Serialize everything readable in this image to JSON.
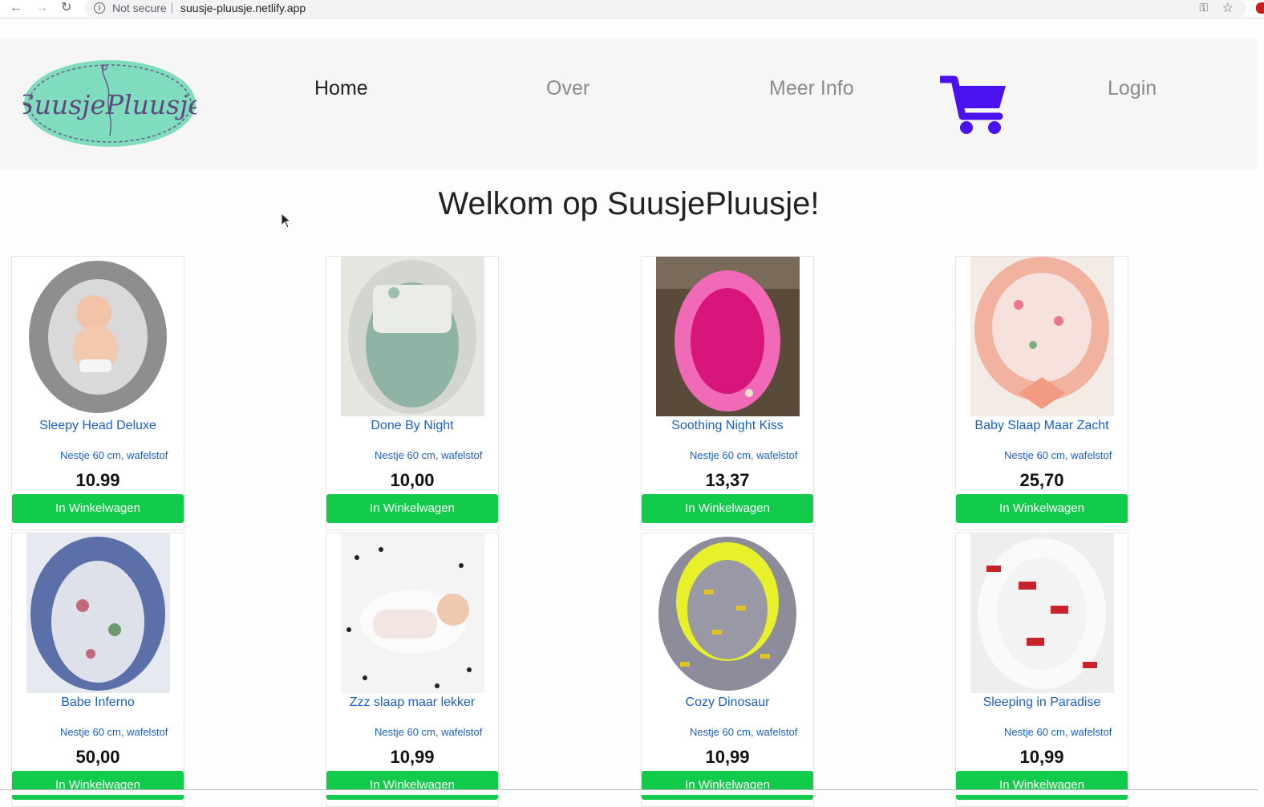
{
  "browser": {
    "security_label": "Not secure",
    "url": "suusje-pluusje.netlify.app"
  },
  "header": {
    "logo_text": "SuusjePluusje",
    "nav": {
      "home": "Home",
      "over": "Over",
      "meer_info": "Meer Info",
      "login": "Login"
    },
    "cart_icon": "shopping-cart-icon",
    "cart_color": "#4a12f0"
  },
  "main": {
    "title": "Welkom op SuusjePluusje!"
  },
  "products": [
    {
      "name": "Sleepy Head Deluxe",
      "desc": "Nestje 60 cm, wafelstof",
      "price": "10.99",
      "button": "In Winkelwagen"
    },
    {
      "name": "Done By Night",
      "desc": "Nestje 60 cm, wafelstof",
      "price": "10,00",
      "button": "In Winkelwagen"
    },
    {
      "name": "Soothing Night Kiss",
      "desc": "Nestje 60 cm, wafelstof",
      "price": "13,37",
      "button": "In Winkelwagen"
    },
    {
      "name": "Baby Slaap Maar Zacht",
      "desc": "Nestje 60 cm, wafelstof",
      "price": "25,70",
      "button": "In Winkelwagen"
    },
    {
      "name": "Babe Inferno",
      "desc": "Nestje 60 cm, wafelstof",
      "price": "50,00",
      "button": "In Winkelwagen"
    },
    {
      "name": "Zzz slaap maar lekker",
      "desc": "Nestje 60 cm, wafelstof",
      "price": "10,99",
      "button": "In Winkelwagen"
    },
    {
      "name": "Cozy Dinosaur",
      "desc": "Nestje 60 cm, wafelstof",
      "price": "10,99",
      "button": "In Winkelwagen"
    },
    {
      "name": "Sleeping in Paradise",
      "desc": "Nestje 60 cm, wafelstof",
      "price": "10,99",
      "button": "In Winkelwagen"
    }
  ],
  "colors": {
    "button_green": "#13cb4b",
    "link_blue": "#1a5fc5",
    "logo_mint": "#7fdcbf"
  }
}
